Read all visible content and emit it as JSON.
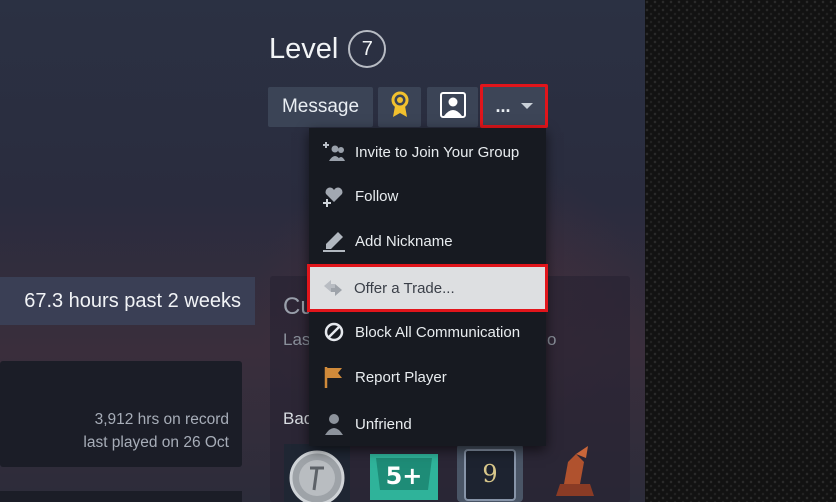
{
  "profile": {
    "level_label": "Level",
    "level_value": "7"
  },
  "actions": {
    "message_label": "Message",
    "more_label": "...",
    "award_icon": "award-icon",
    "profile_icon": "profile-icon"
  },
  "dropdown": {
    "items": [
      {
        "label": "Invite to Join Your Group",
        "icon": "group-invite-icon"
      },
      {
        "label": "Follow",
        "icon": "heart-plus-icon"
      },
      {
        "label": "Add Nickname",
        "icon": "pencil-icon"
      },
      {
        "label": "Offer a Trade...",
        "icon": "trade-arrows-icon"
      },
      {
        "label": "Block All Communication",
        "icon": "block-icon"
      },
      {
        "label": "Report Player",
        "icon": "flag-icon"
      },
      {
        "label": "Unfriend",
        "icon": "person-icon"
      }
    ]
  },
  "activity": {
    "hours_summary": "67.3 hours past 2 weeks",
    "game": {
      "hours_on_record": "3,912 hrs on record",
      "last_played": "last played on 26 Oct"
    }
  },
  "panel": {
    "title_partial": "Cu",
    "subtitle_partial": "Las",
    "subtitle_tail": "o",
    "badges_partial": "Bad"
  },
  "badges": {
    "third_number": "9",
    "second_text": "5+"
  },
  "colors": {
    "highlight": "#e1151b",
    "menu_bg": "#171a21",
    "button_bg": "#3b4456"
  }
}
